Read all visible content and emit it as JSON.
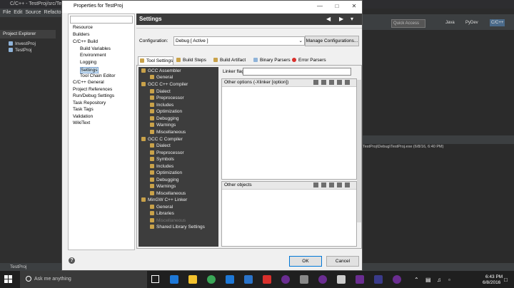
{
  "eclipse": {
    "window_title": "C/C++ - TestProj/src/Test",
    "menu": [
      "File",
      "Edit",
      "Source",
      "Refacto"
    ],
    "project_explorer_tab": "Project Explorer",
    "projects": [
      "InvestProj",
      "TestProj"
    ],
    "quick_access": "Quick Access",
    "perspectives": [
      "Java",
      "PyDev",
      "C/C++"
    ],
    "console_text": "TestProj\\Debug\\TestProj.exe (6/8/16, 6:40 PM)",
    "status_text": "TestProj"
  },
  "dialog": {
    "title": "Properties for TestProj",
    "nav": {
      "resource": "Resource",
      "builders": "Builders",
      "cpp_build": "C/C++ Build",
      "build_variables": "Build Variables",
      "environment": "Environment",
      "logging": "Logging",
      "settings": "Settings",
      "tool_chain_editor": "Tool Chain Editor",
      "cpp_general": "C/C++ General",
      "project_references": "Project References",
      "run_debug_settings": "Run/Debug Settings",
      "task_repository": "Task Repository",
      "task_tags": "Task Tags",
      "validation": "Validation",
      "wikitext": "WikiText"
    },
    "settings_title": "Settings",
    "configuration_label": "Configuration:",
    "configuration_value": "Debug  [ Active ]",
    "manage_button": "Manage Configurations...",
    "tabs": {
      "tool_settings": "Tool Settings",
      "build_steps": "Build Steps",
      "build_artifact": "Build Artifact",
      "binary_parsers": "Binary Parsers",
      "error_parsers": "Error Parsers"
    },
    "tools": {
      "gcc_assembler": "GCC Assembler",
      "asm_general": "General",
      "gcc_cpp_compiler": "GCC C++ Compiler",
      "cpp_dialect": "Dialect",
      "cpp_preprocessor": "Preprocessor",
      "cpp_includes": "Includes",
      "cpp_optimization": "Optimization",
      "cpp_debugging": "Debugging",
      "cpp_warnings": "Warnings",
      "cpp_miscellaneous": "Miscellaneous",
      "gcc_c_compiler": "GCC C Compiler",
      "c_dialect": "Dialect",
      "c_preprocessor": "Preprocessor",
      "c_symbols": "Symbols",
      "c_includes": "Includes",
      "c_optimization": "Optimization",
      "c_debugging": "Debugging",
      "c_warnings": "Warnings",
      "c_miscellaneous": "Miscellaneous",
      "mingw_linker": "MinGW C++ Linker",
      "linker_general": "General",
      "linker_libraries": "Libraries",
      "linker_miscellaneous": "Miscellaneous",
      "shared_library_settings": "Shared Library Settings"
    },
    "linker_flags_label": "Linker flags",
    "other_options_label": "Other options (-Xlinker [option])",
    "other_objects_label": "Other objects",
    "ok_button": "OK",
    "cancel_button": "Cancel"
  },
  "taskbar": {
    "search_placeholder": "Ask me anything",
    "time": "6:43 PM",
    "date": "6/8/2016"
  },
  "colors": {
    "dark_bg": "#2b2b2b",
    "dialog_bg": "#f0f0f0",
    "accent": "#0078d7",
    "taskbar": "#1f1f1f"
  }
}
